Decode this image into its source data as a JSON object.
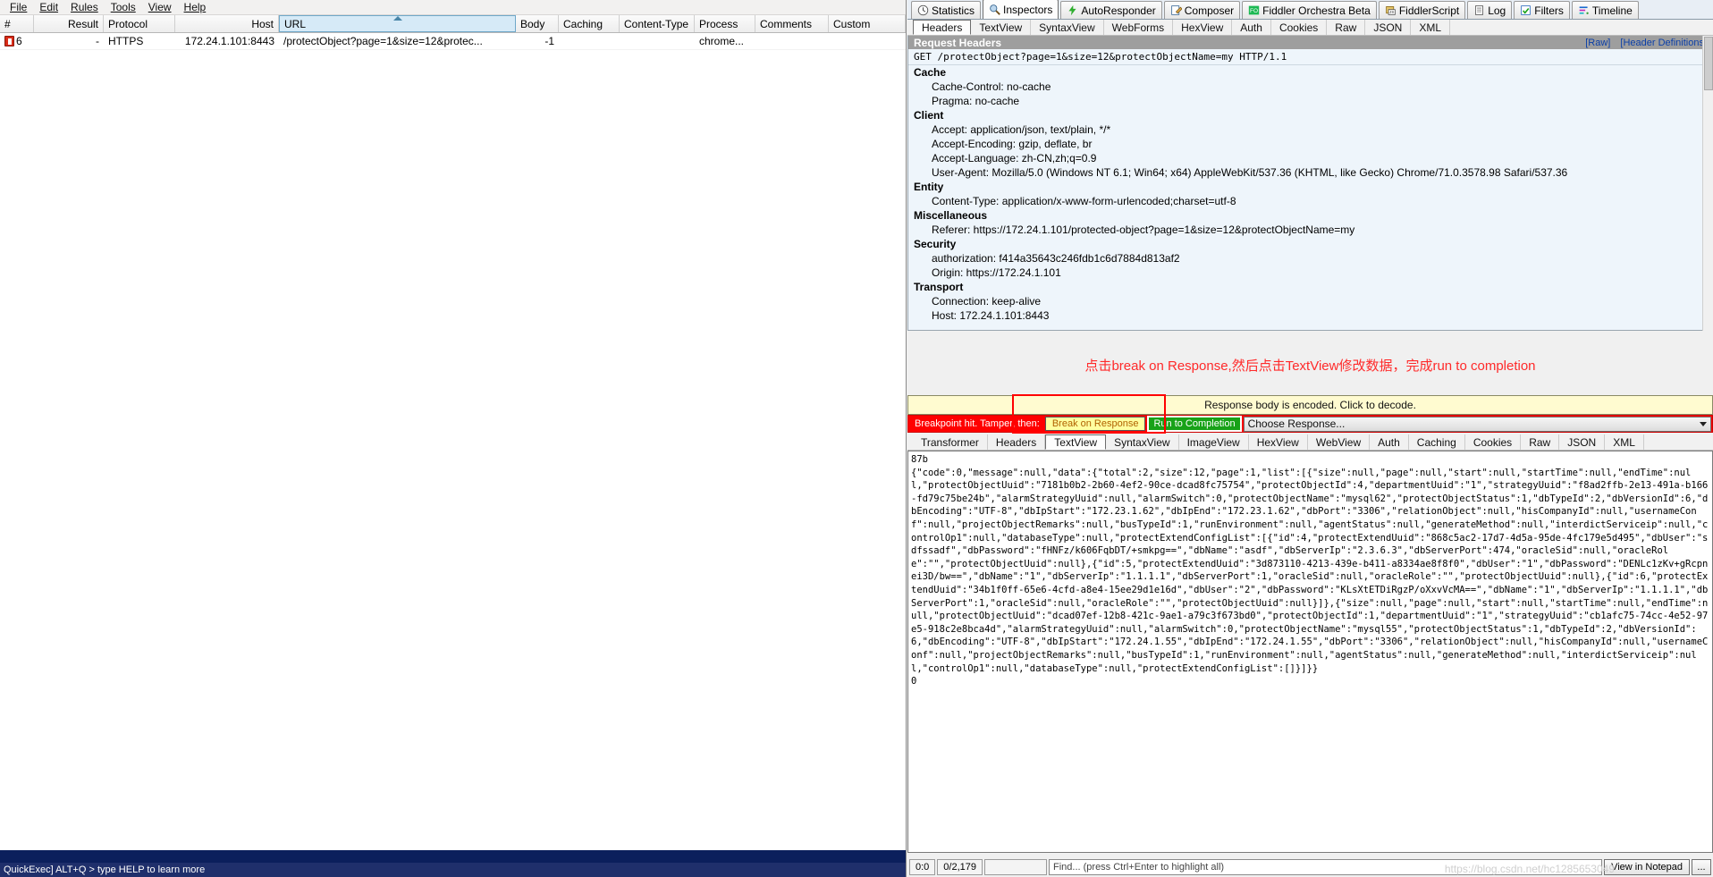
{
  "menu": {
    "items": [
      "File",
      "Edit",
      "Rules",
      "Tools",
      "View",
      "Help"
    ]
  },
  "sessions": {
    "columns": [
      "#",
      "Result",
      "Protocol",
      "Host",
      "URL",
      "Body",
      "Caching",
      "Content-Type",
      "Process",
      "Comments",
      "Custom"
    ],
    "sorted_column": "URL",
    "rows": [
      {
        "num": "6",
        "result": "-",
        "protocol": "HTTPS",
        "host": "172.24.1.101:8443",
        "url": "/protectObject?page=1&size=12&protec...",
        "body": "-1",
        "caching": "",
        "content_type": "",
        "process": "chrome...",
        "comments": "",
        "custom": ""
      }
    ]
  },
  "left_status": {
    "line1": "QuickExec] ALT+Q > type HELP to learn more",
    "line2": ""
  },
  "top_tabs": [
    {
      "label": "Statistics",
      "icon": "clock-icon",
      "active": false
    },
    {
      "label": "Inspectors",
      "icon": "magnifier-icon",
      "active": true
    },
    {
      "label": "AutoResponder",
      "icon": "lightning-icon",
      "active": false
    },
    {
      "label": "Composer",
      "icon": "compose-icon",
      "active": false
    },
    {
      "label": "Fiddler Orchestra Beta",
      "icon": "fo-icon",
      "active": false
    },
    {
      "label": "FiddlerScript",
      "icon": "script-icon",
      "active": false
    },
    {
      "label": "Log",
      "icon": "log-icon",
      "active": false
    },
    {
      "label": "Filters",
      "icon": "check-icon",
      "active": false
    },
    {
      "label": "Timeline",
      "icon": "timeline-icon",
      "active": false
    }
  ],
  "request_tabs": [
    {
      "label": "Headers",
      "active": true
    },
    {
      "label": "TextView",
      "active": false
    },
    {
      "label": "SyntaxView",
      "active": false
    },
    {
      "label": "WebForms",
      "active": false
    },
    {
      "label": "HexView",
      "active": false
    },
    {
      "label": "Auth",
      "active": false
    },
    {
      "label": "Cookies",
      "active": false
    },
    {
      "label": "Raw",
      "active": false
    },
    {
      "label": "JSON",
      "active": false
    },
    {
      "label": "XML",
      "active": false
    }
  ],
  "request_headers": {
    "title": "Request Headers",
    "raw_link": "[Raw]",
    "defs_link": "[Header Definitions]",
    "request_line": "GET /protectObject?page=1&size=12&protectObjectName=my HTTP/1.1",
    "groups": [
      {
        "name": "Cache",
        "items": [
          "Cache-Control: no-cache",
          "Pragma: no-cache"
        ]
      },
      {
        "name": "Client",
        "items": [
          "Accept: application/json, text/plain, */*",
          "Accept-Encoding: gzip, deflate, br",
          "Accept-Language: zh-CN,zh;q=0.9",
          "User-Agent: Mozilla/5.0 (Windows NT 6.1; Win64; x64) AppleWebKit/537.36 (KHTML, like Gecko) Chrome/71.0.3578.98 Safari/537.36"
        ]
      },
      {
        "name": "Entity",
        "items": [
          "Content-Type: application/x-www-form-urlencoded;charset=utf-8"
        ]
      },
      {
        "name": "Miscellaneous",
        "items": [
          "Referer: https://172.24.1.101/protected-object?page=1&size=12&protectObjectName=my"
        ]
      },
      {
        "name": "Security",
        "items": [
          "authorization: f414a35643c246fdb1c6d7884d813af2",
          "Origin: https://172.24.1.101"
        ]
      },
      {
        "name": "Transport",
        "items": [
          "Connection: keep-alive",
          "Host: 172.24.1.101:8443"
        ]
      }
    ]
  },
  "annotation": "点击break on Response,然后点击TextView修改数据，完成run to completion",
  "encoded_notice": "Response body is encoded. Click to decode.",
  "breakpoint_bar": {
    "label": "Breakpoint hit. Tamper, then:",
    "break_button": "Break on Response",
    "run_button": "Run to Completion",
    "choose_response": "Choose Response..."
  },
  "response_tabs": [
    {
      "label": "Transformer",
      "active": false
    },
    {
      "label": "Headers",
      "active": false
    },
    {
      "label": "TextView",
      "active": true
    },
    {
      "label": "SyntaxView",
      "active": false
    },
    {
      "label": "ImageView",
      "active": false
    },
    {
      "label": "HexView",
      "active": false
    },
    {
      "label": "WebView",
      "active": false
    },
    {
      "label": "Auth",
      "active": false
    },
    {
      "label": "Caching",
      "active": false
    },
    {
      "label": "Cookies",
      "active": false
    },
    {
      "label": "Raw",
      "active": false
    },
    {
      "label": "JSON",
      "active": false
    },
    {
      "label": "XML",
      "active": false
    }
  ],
  "response_body": "87b\n{\"code\":0,\"message\":null,\"data\":{\"total\":2,\"size\":12,\"page\":1,\"list\":[{\"size\":null,\"page\":null,\"start\":null,\"startTime\":null,\"endTime\":null,\"protectObjectUuid\":\"7181b0b2-2b60-4ef2-90ce-dcad8fc75754\",\"protectObjectId\":4,\"departmentUuid\":\"1\",\"strategyUuid\":\"f8ad2ffb-2e13-491a-b166-fd79c75be24b\",\"alarmStrategyUuid\":null,\"alarmSwitch\":0,\"protectObjectName\":\"mysql62\",\"protectObjectStatus\":1,\"dbTypeId\":2,\"dbVersionId\":6,\"dbEncoding\":\"UTF-8\",\"dbIpStart\":\"172.23.1.62\",\"dbIpEnd\":\"172.23.1.62\",\"dbPort\":\"3306\",\"relationObject\":null,\"hisCompanyId\":null,\"usernameConf\":null,\"projectObjectRemarks\":null,\"busTypeId\":1,\"runEnvironment\":null,\"agentStatus\":null,\"generateMethod\":null,\"interdictServiceip\":null,\"controlOp1\":null,\"databaseType\":null,\"protectExtendConfigList\":[{\"id\":4,\"protectExtendUuid\":\"868c5ac2-17d7-4d5a-95de-4fc179e5d495\",\"dbUser\":\"sdfssadf\",\"dbPassword\":\"fHNFz/k606FqbDT/+smkpg==\",\"dbName\":\"asdf\",\"dbServerIp\":\"2.3.6.3\",\"dbServerPort\":474,\"oracleSid\":null,\"oracleRole\":\"\",\"protectObjectUuid\":null},{\"id\":5,\"protectExtendUuid\":\"3d873110-4213-439e-b411-a8334ae8f8f0\",\"dbUser\":\"1\",\"dbPassword\":\"DENLc1zKv+gRcpnei3D/bw==\",\"dbName\":\"1\",\"dbServerIp\":\"1.1.1.1\",\"dbServerPort\":1,\"oracleSid\":null,\"oracleRole\":\"\",\"protectObjectUuid\":null},{\"id\":6,\"protectExtendUuid\":\"34b1f0ff-65e6-4cfd-a8e4-15ee29d1e16d\",\"dbUser\":\"2\",\"dbPassword\":\"KLsXtETDiRgzP/oXxvVcMA==\",\"dbName\":\"1\",\"dbServerIp\":\"1.1.1.1\",\"dbServerPort\":1,\"oracleSid\":null,\"oracleRole\":\"\",\"protectObjectUuid\":null}]},{\"size\":null,\"page\":null,\"start\":null,\"startTime\":null,\"endTime\":null,\"protectObjectUuid\":\"dcad07ef-12b8-421c-9ae1-a79c3f673bd0\",\"protectObjectId\":1,\"departmentUuid\":\"1\",\"strategyUuid\":\"cb1afc75-74cc-4e52-97e5-918c2e8bca4d\",\"alarmStrategyUuid\":null,\"alarmSwitch\":0,\"protectObjectName\":\"mysql55\",\"protectObjectStatus\":1,\"dbTypeId\":2,\"dbVersionId\":6,\"dbEncoding\":\"UTF-8\",\"dbIpStart\":\"172.24.1.55\",\"dbIpEnd\":\"172.24.1.55\",\"dbPort\":\"3306\",\"relationObject\":null,\"hisCompanyId\":null,\"usernameConf\":null,\"projectObjectRemarks\":null,\"busTypeId\":1,\"runEnvironment\":null,\"agentStatus\":null,\"generateMethod\":null,\"interdictServiceip\":null,\"controlOp1\":null,\"databaseType\":null,\"protectExtendConfigList\":[]}]}}\n0",
  "response_status": {
    "position": "0:0",
    "selection": "0/2,179",
    "find_placeholder": "Find... (press Ctrl+Enter to highlight all)",
    "notepad_button": "View in Notepad",
    "more_button": "...",
    "watermark": "https://blog.csdn.net/hc1285653049"
  }
}
